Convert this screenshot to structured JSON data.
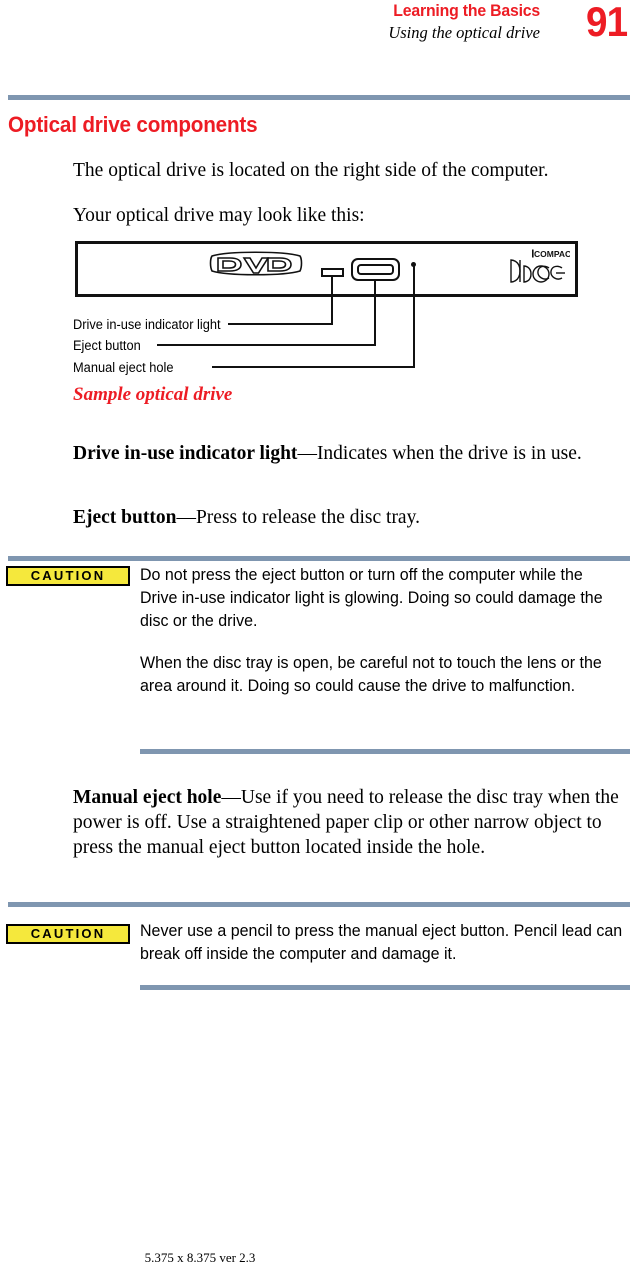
{
  "header": {
    "chapter": "Learning the Basics",
    "section": "Using the optical drive",
    "page_number": "91",
    "rule_color": "#7f96b0"
  },
  "section": {
    "title": "Optical drive components",
    "title_color": "#ed1c24"
  },
  "body": {
    "p_located": "The optical drive is located on the right side of the computer.",
    "p_looklike": "Your optical drive may look like this:",
    "p_in_use_light": "Drive in-use indicator light—Indicates when the drive is in use.",
    "p_in_use_light_bold": "Drive in-use indicator light",
    "p_in_use_light_rest": "—Indicates when the drive is in use.",
    "p_eject_bold": "Eject button",
    "p_eject_rest": "—Press to release the disc tray.",
    "p_manual_bold": "Manual eject hole",
    "p_manual_rest": "—Use if you need to release the disc tray when the power is off. Use a straightened paper clip or other narrow object to press the manual eject button located inside the hole."
  },
  "figure": {
    "caption": "Sample optical drive",
    "caption_color": "#ed1c24",
    "dvd_logo_text": "DVD",
    "cd_logo_top_text": "COMPACT",
    "cd_logo_main_text": "disc",
    "callouts": [
      {
        "label": "Drive in-use indicator light"
      },
      {
        "label": "Eject button"
      },
      {
        "label": "Manual eject hole"
      }
    ]
  },
  "cautions": [
    {
      "badge": "CAUTION",
      "badge_bg": "#f5e83c",
      "paragraphs": [
        "Do not press the eject button or turn off the computer while the Drive in-use indicator light is glowing. Doing so could damage the disc or the drive.",
        "When the disc tray is open, be careful not to touch the lens or the area around it. Doing so could cause the drive to malfunction."
      ]
    },
    {
      "badge": "CAUTION",
      "badge_bg": "#f5e83c",
      "paragraphs": [
        "Never use a pencil to press the manual eject button. Pencil lead can break off inside the computer and damage it."
      ]
    }
  ],
  "footer": {
    "text": "5.375 x 8.375 ver 2.3"
  }
}
